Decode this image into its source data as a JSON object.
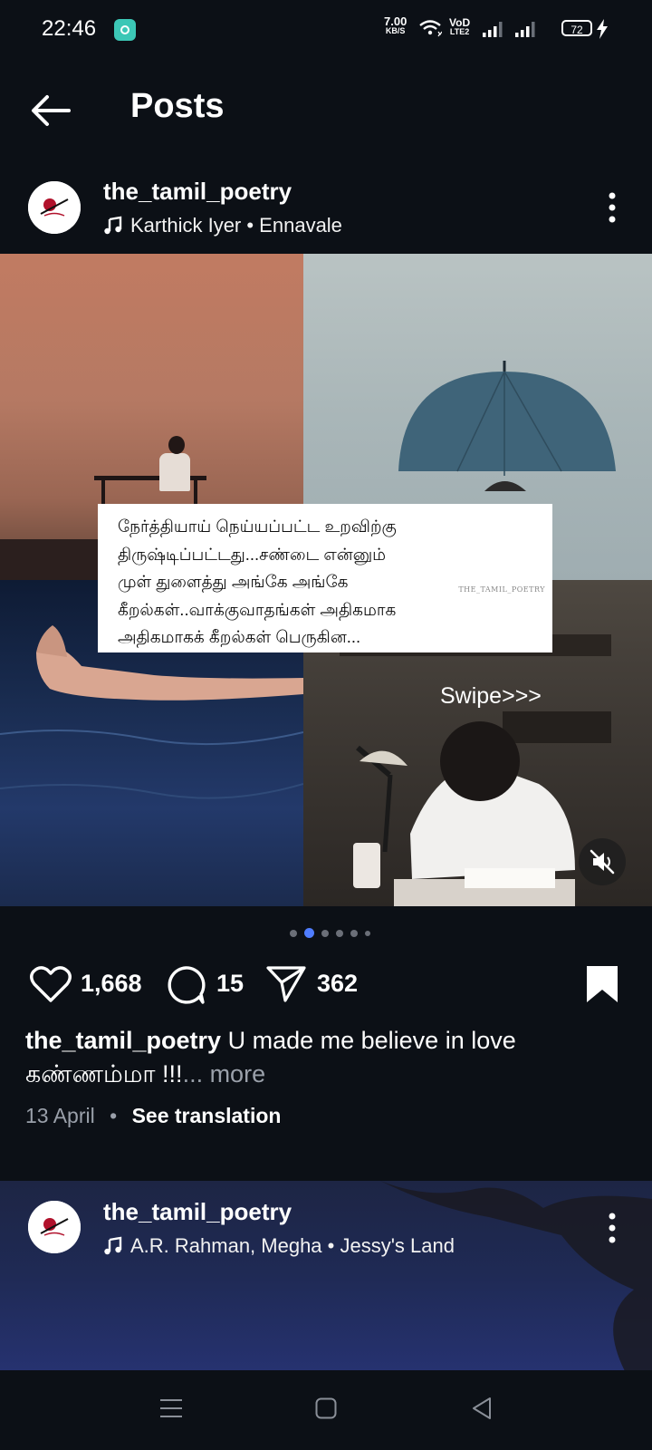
{
  "status_bar": {
    "time": "22:46",
    "speed_value": "7.00",
    "speed_unit": "KB/S",
    "volte_top": "VoD",
    "volte_bottom": "LTE2",
    "battery": "72"
  },
  "header": {
    "title": "Posts"
  },
  "post1": {
    "username": "the_tamil_poetry",
    "music": "Karthick Iyer • Ennavale",
    "quote_lines": [
      "நேர்த்தியாய் நெய்யப்பட்ட உறவிற்கு",
      "திருஷ்டிப்பட்டது...சண்டை என்னும்",
      "முள் துளைத்து அங்கே அங்கே",
      "கீறல்கள்..வாக்குவாதங்கள் அதிகமாக",
      "அதிகமாகக் கீறல்கள் பெருகின..."
    ],
    "watermark": "THE_TAMIL_POETRY",
    "swipe": "Swipe>>>",
    "carousel": {
      "count": 6,
      "active_index": 1
    },
    "likes": "1,668",
    "comments": "15",
    "shares": "362",
    "caption_user": "the_tamil_poetry",
    "caption_line1": " U made me believe in love",
    "caption_line2": "கண்ணம்மா !!!",
    "caption_more": "... more",
    "date": "13 April",
    "separator": "•",
    "see_translation": "See translation"
  },
  "post2": {
    "username": "the_tamil_poetry",
    "music": "A.R. Rahman, Megha • Jessy's Land"
  },
  "colors": {
    "background": "#0c1016",
    "accent_dot": "#4f7dff"
  }
}
